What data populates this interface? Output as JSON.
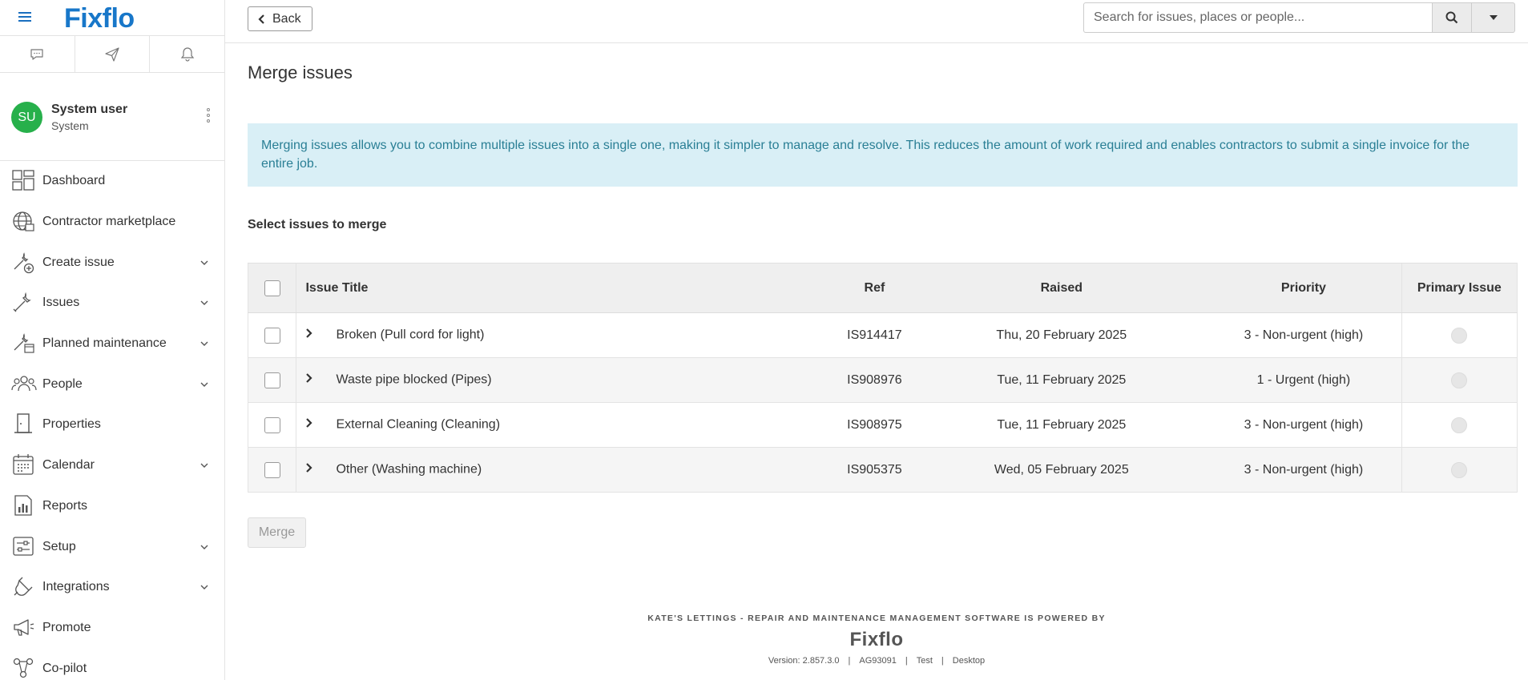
{
  "app": {
    "logo_text": "Fixflo",
    "brand_color": "#1877c9"
  },
  "user": {
    "initials": "SU",
    "name": "System user",
    "role": "System",
    "avatar_color": "#27b04b"
  },
  "sidebar": {
    "quick_icons": [
      "comment-icon",
      "send-icon",
      "bell-icon"
    ],
    "items": [
      {
        "label": "Dashboard",
        "icon": "dashboard-icon",
        "expandable": false
      },
      {
        "label": "Contractor marketplace",
        "icon": "globe-icon",
        "expandable": false
      },
      {
        "label": "Create issue",
        "icon": "wrench-plus-icon",
        "expandable": true
      },
      {
        "label": "Issues",
        "icon": "wrench-icon",
        "expandable": true
      },
      {
        "label": "Planned maintenance",
        "icon": "wrench-calendar-icon",
        "expandable": true
      },
      {
        "label": "People",
        "icon": "people-icon",
        "expandable": true
      },
      {
        "label": "Properties",
        "icon": "door-icon",
        "expandable": false
      },
      {
        "label": "Calendar",
        "icon": "calendar-icon",
        "expandable": true
      },
      {
        "label": "Reports",
        "icon": "report-icon",
        "expandable": false
      },
      {
        "label": "Setup",
        "icon": "sliders-icon",
        "expandable": true
      },
      {
        "label": "Integrations",
        "icon": "plug-icon",
        "expandable": true
      },
      {
        "label": "Promote",
        "icon": "megaphone-icon",
        "expandable": false
      },
      {
        "label": "Co-pilot",
        "icon": "copilot-icon",
        "expandable": false
      }
    ]
  },
  "header": {
    "back_label": "Back",
    "search_placeholder": "Search for issues, places or people..."
  },
  "main": {
    "title": "Merge issues",
    "info": "Merging issues allows you to combine multiple issues into a single one, making it simpler to manage and resolve. This reduces the amount of work required and enables contractors to submit a single invoice for the entire job.",
    "section_label": "Select issues to merge",
    "columns": {
      "title": "Issue Title",
      "ref": "Ref",
      "raised": "Raised",
      "priority": "Priority",
      "primary": "Primary Issue"
    },
    "rows": [
      {
        "title": "Broken (Pull cord for light)",
        "ref": "IS914417",
        "raised": "Thu, 20 February 2025",
        "priority": "3 - Non-urgent (high)"
      },
      {
        "title": "Waste pipe blocked (Pipes)",
        "ref": "IS908976",
        "raised": "Tue, 11 February 2025",
        "priority": "1 - Urgent (high)"
      },
      {
        "title": "External Cleaning (Cleaning)",
        "ref": "IS908975",
        "raised": "Tue, 11 February 2025",
        "priority": "3 - Non-urgent (high)"
      },
      {
        "title": "Other (Washing machine)",
        "ref": "IS905375",
        "raised": "Wed, 05 February 2025",
        "priority": "3 - Non-urgent (high)"
      }
    ],
    "merge_label": "Merge"
  },
  "footer": {
    "powered": "KATE'S LETTINGS - REPAIR AND MAINTENANCE MANAGEMENT SOFTWARE IS POWERED BY",
    "logo": "Fixflo",
    "version": "Version: 2.857.3.0",
    "agency": "AG93091",
    "env": "Test",
    "mode": "Desktop",
    "separator": "|"
  }
}
